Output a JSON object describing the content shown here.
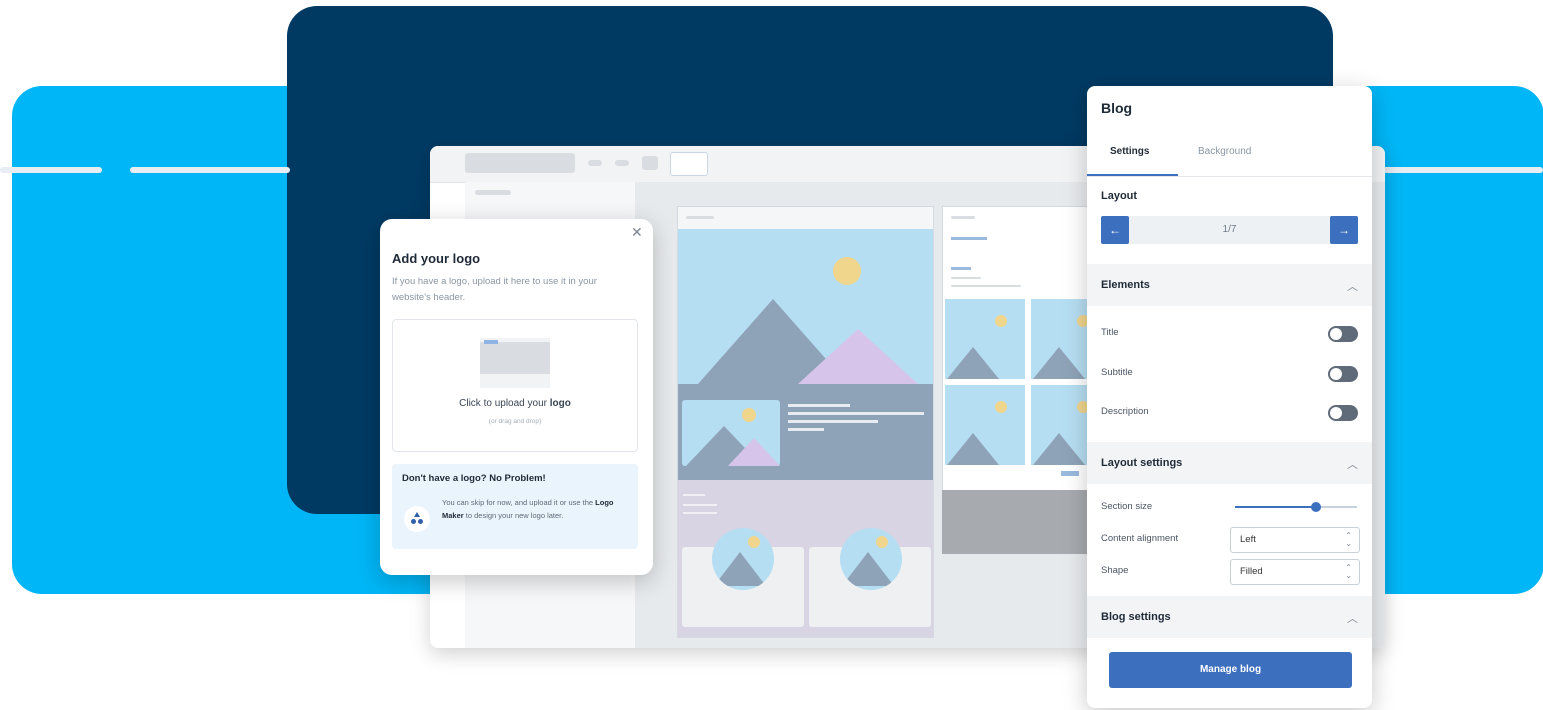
{
  "logo_dialog": {
    "title": "Add your logo",
    "description": "If you have a logo, upload it here to use it in your website's header.",
    "upload_prefix": "Click to upload your ",
    "upload_bold": "logo",
    "upload_hint": "(or drag and drop)",
    "tip_title": "Don't have a logo? No Problem!",
    "tip_text_prefix": "You can skip for now, and upload it or use the ",
    "tip_link": "Logo Maker",
    "tip_text_suffix": " to design your new logo later.",
    "close_icon": "close-icon"
  },
  "blog_panel": {
    "title": "Blog",
    "tabs": [
      {
        "label": "Settings",
        "active": true
      },
      {
        "label": "Background",
        "active": false
      }
    ],
    "layout": {
      "label": "Layout",
      "page": "1/7"
    },
    "elements": {
      "label": "Elements",
      "items": [
        {
          "label": "Title",
          "on": false
        },
        {
          "label": "Subtitle",
          "on": false
        },
        {
          "label": "Description",
          "on": false
        }
      ]
    },
    "layout_settings": {
      "label": "Layout settings",
      "section_size_label": "Section size",
      "section_size_value": 0.66,
      "content_alignment_label": "Content alignment",
      "content_alignment_value": "Left",
      "shape_label": "Shape",
      "shape_value": "Filled"
    },
    "blog_settings": {
      "label": "Blog settings"
    },
    "manage_button": "Manage blog"
  },
  "colors": {
    "light_blue": "#00b6f6",
    "navy": "#003a63",
    "accent": "#3d6fbf"
  }
}
